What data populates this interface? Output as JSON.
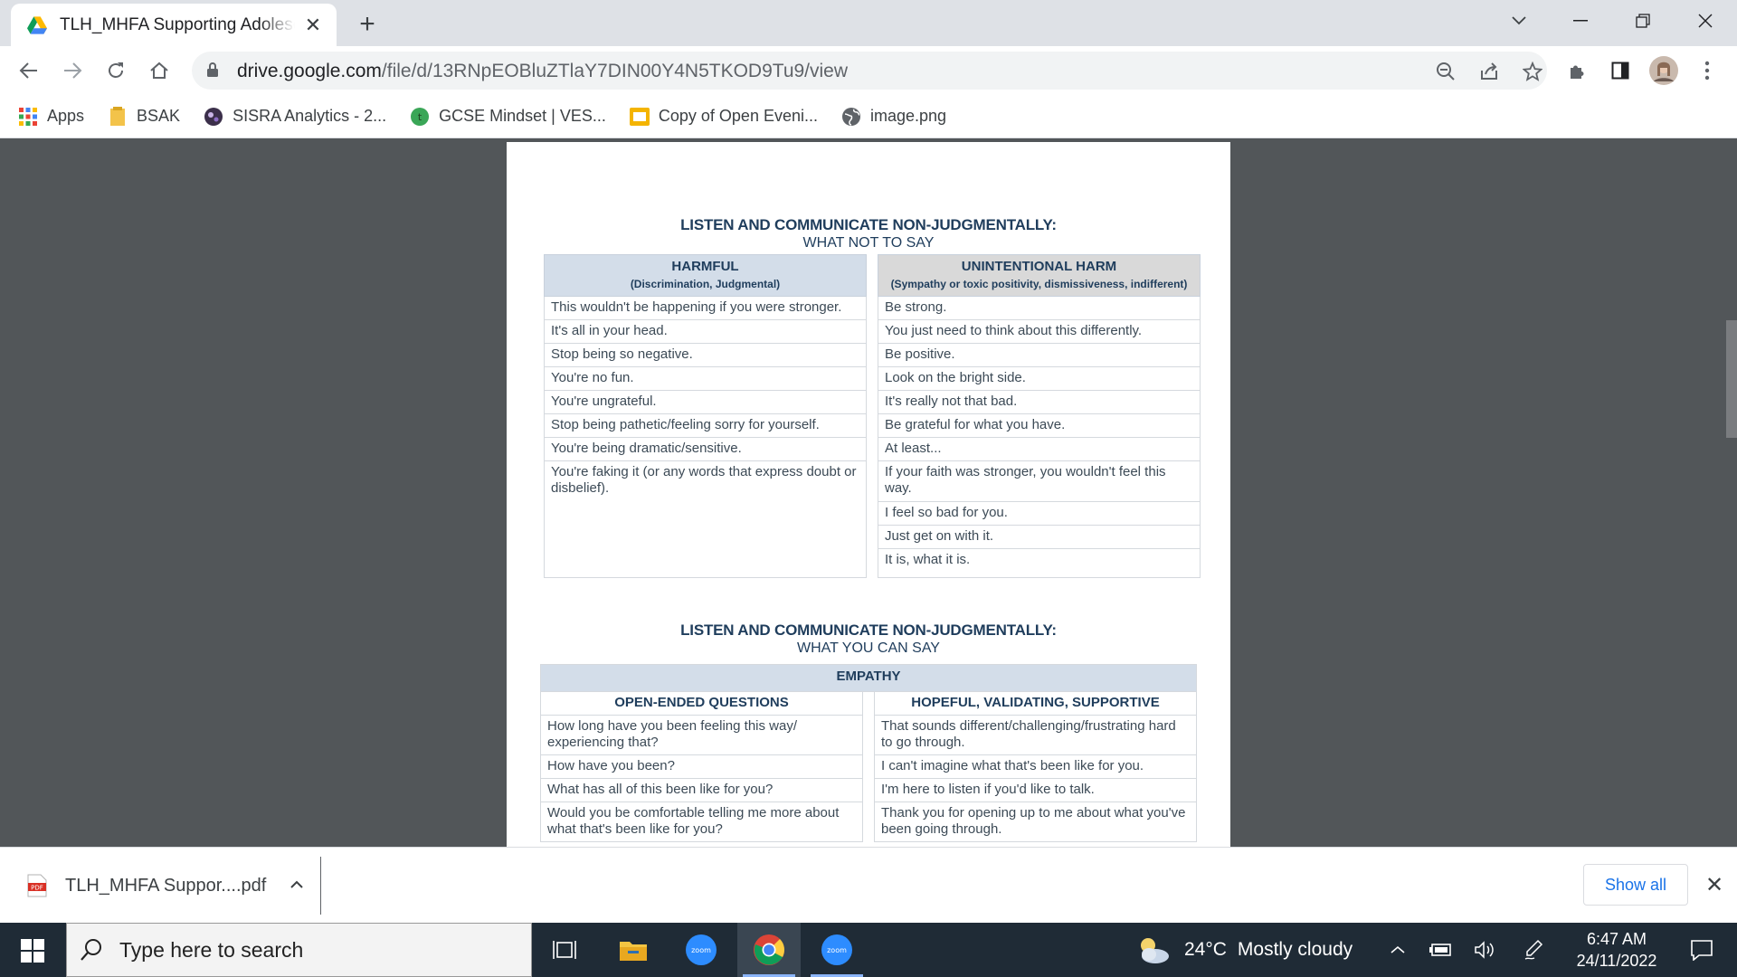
{
  "browser": {
    "tab_title": "TLH_MHFA Supporting Adolescents",
    "tab_close": "✕",
    "new_tab": "+",
    "url_host": "drive.google.com",
    "url_path": "/file/d/13RNpEOBluZTlaY7DIN00Y4N5TKOD9Tu9/view",
    "window_controls": [
      "minimize",
      "restore",
      "close"
    ]
  },
  "bookmarks": [
    {
      "label": "Apps",
      "icon": "apps-grid-icon"
    },
    {
      "label": "BSAK",
      "icon": "folder-icon"
    },
    {
      "label": "SISRA Analytics - 2...",
      "icon": "sisra-icon"
    },
    {
      "label": "GCSE Mindset | VES...",
      "icon": "tassomai-icon"
    },
    {
      "label": "Copy of Open Eveni...",
      "icon": "slides-icon"
    },
    {
      "label": "image.png",
      "icon": "globe-icon"
    }
  ],
  "document": {
    "section1": {
      "title": "LISTEN AND COMMUNICATE NON-JUDGMENTALLY:",
      "subtitle": "WHAT NOT TO SAY",
      "harmful": {
        "heading": "HARMFUL",
        "subheading": "(Discrimination, Judgmental)",
        "items": [
          "This wouldn't be happening if you were stronger.",
          "It's all in your head.",
          "Stop being so negative.",
          "You're no fun.",
          "You're ungrateful.",
          "Stop being pathetic/feeling sorry for yourself.",
          "You're being dramatic/sensitive.",
          "You're faking it (or any words that express doubt or disbelief)."
        ]
      },
      "unintentional": {
        "heading": "UNINTENTIONAL HARM",
        "subheading": "(Sympathy or toxic positivity, dismissiveness, indifferent)",
        "items": [
          "Be strong.",
          "You just need to think about this differently.",
          "Be positive.",
          "Look on the bright side.",
          "It's really not that bad.",
          "Be grateful for what you have.",
          "At least...",
          "If your faith was stronger, you wouldn't feel this way.",
          "I feel so bad for you.",
          "Just get on with it.",
          "It is, what it is."
        ]
      }
    },
    "section2": {
      "title": "LISTEN AND COMMUNICATE NON-JUDGMENTALLY:",
      "subtitle": "WHAT YOU CAN SAY",
      "band": "EMPATHY",
      "open": {
        "heading": "OPEN-ENDED QUESTIONS",
        "items": [
          "How long have you been feeling this way/ experiencing that?",
          "How have you been?",
          "What has all of this been like for you?",
          "Would you be comfortable telling me more about what that's been like for you?"
        ]
      },
      "hopeful": {
        "heading": "HOPEFUL, VALIDATING, SUPPORTIVE",
        "items": [
          "That sounds different/challenging/frustrating hard to go through.",
          "I can't imagine what that's been like for you.",
          "I'm here to listen if you'd like to talk.",
          "Thank you for opening up to me about what you've been going through."
        ]
      }
    }
  },
  "download_bar": {
    "file_name": "TLH_MHFA Suppor....pdf",
    "file_badge": "PDF",
    "show_all": "Show all",
    "close": "✕"
  },
  "taskbar": {
    "search_placeholder": "Type here to search",
    "weather_temp": "24°C",
    "weather_text": "Mostly cloudy",
    "time": "6:47 AM",
    "date": "24/11/2022",
    "zoom_label": "zoom"
  },
  "colors": {
    "heading_navy": "#1f3d5c",
    "header_blue": "#d3dde9",
    "header_grey": "#d9d9d9",
    "viewer_bg": "#525659",
    "taskbar_bg": "#1f2b36",
    "link_blue": "#1a73e8"
  }
}
